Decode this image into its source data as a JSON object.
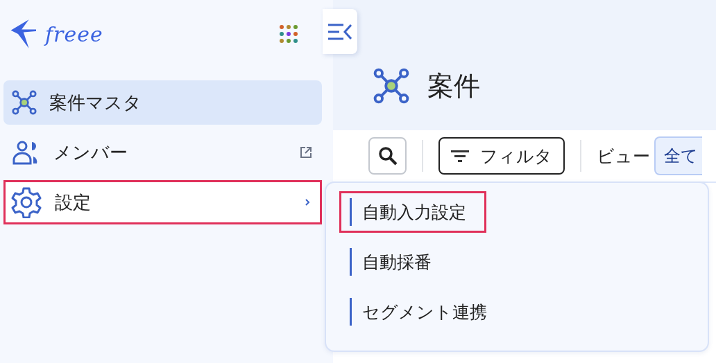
{
  "app": {
    "logo": "freee"
  },
  "sidebar": {
    "items": [
      {
        "label": "案件マスタ",
        "kind": "nodes",
        "selected": true,
        "external": false,
        "submenu": false,
        "annotated": false
      },
      {
        "label": "メンバー",
        "kind": "people",
        "selected": false,
        "external": true,
        "submenu": false,
        "annotated": false
      },
      {
        "label": "設定",
        "kind": "gear",
        "selected": false,
        "external": false,
        "submenu": true,
        "annotated": true
      }
    ]
  },
  "page": {
    "title": "案件"
  },
  "toolbar": {
    "filter_label": "フィルタ",
    "view_label": "ビュー",
    "view_tabs": [
      {
        "label": "全て",
        "selected": true
      }
    ]
  },
  "submenu": {
    "items": [
      {
        "label": "自動入力設定",
        "annotated": true
      },
      {
        "label": "自動採番",
        "annotated": false
      },
      {
        "label": "セグメント連携",
        "annotated": false
      }
    ]
  }
}
